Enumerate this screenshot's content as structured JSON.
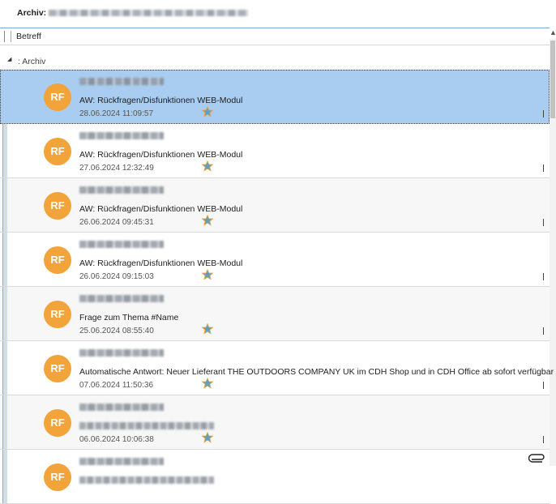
{
  "header": {
    "archive_label": "Archiv:"
  },
  "columns": {
    "subject_header": "Betreff"
  },
  "group": {
    "label": ": Archiv"
  },
  "messages": [
    {
      "initials": "RF",
      "subject": "AW: Rückfragen/Disfunktionen WEB-Modul",
      "date": "28.06.2024 11:09:57",
      "selected": true
    },
    {
      "initials": "RF",
      "subject": "AW: Rückfragen/Disfunktionen WEB-Modul",
      "date": "27.06.2024 12:32:49"
    },
    {
      "initials": "RF",
      "subject": "AW: Rückfragen/Disfunktionen WEB-Modul",
      "date": "26.06.2024 09:45:31"
    },
    {
      "initials": "RF",
      "subject": "AW: Rückfragen/Disfunktionen WEB-Modul",
      "date": "26.06.2024 09:15:03"
    },
    {
      "initials": "RF",
      "subject": "Frage zum Thema #Name",
      "date": "25.06.2024 08:55:40"
    },
    {
      "initials": "RF",
      "subject": "Automatische Antwort: Neuer Lieferant THE OUTDOORS COMPANY UK im CDH Shop und in CDH Office ab sofort verfügbar",
      "date": "07.06.2024 11:50:36"
    },
    {
      "initials": "RF",
      "subject": "",
      "date": "06.06.2024 10:06:38"
    },
    {
      "initials": "RF",
      "subject": "",
      "date": ""
    }
  ],
  "icons": {
    "star": "star-icon",
    "attachment": "paperclip-icon",
    "collapse": "collapse-triangle-icon"
  },
  "colors": {
    "selected_row": "#a9cdf0",
    "avatar": "#f2a33a",
    "star_blue": "#5aa0c8",
    "star_orange": "#e8a23a"
  }
}
